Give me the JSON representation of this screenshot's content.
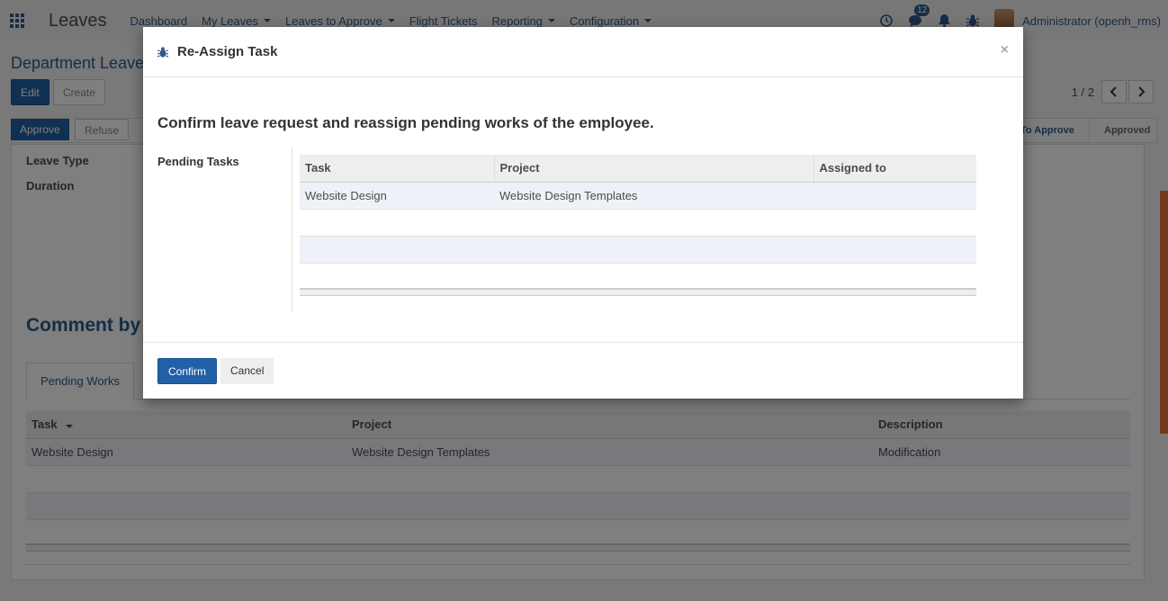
{
  "navbar": {
    "app_name": "Leaves",
    "menu": [
      "Dashboard",
      "My Leaves",
      "Leaves to Approve",
      "Flight Tickets",
      "Reporting",
      "Configuration"
    ],
    "messages_badge": "12",
    "user": "Administrator (openh_rms)"
  },
  "control_panel": {
    "breadcrumb": "Department Leave",
    "edit_label": "Edit",
    "create_label": "Create",
    "pager": "1 / 2"
  },
  "statusbar": {
    "approve_label": "Approve",
    "refuse_label": "Refuse",
    "stage_active": "To Approve",
    "stage_approved": "Approved"
  },
  "form": {
    "leave_type_label": "Leave Type",
    "duration_label": "Duration",
    "comment_title": "Comment by M",
    "tab_pending_works": "Pending Works",
    "table": {
      "columns": [
        "Task",
        "Project",
        "Description"
      ],
      "rows": [
        {
          "task": "Website Design",
          "project": "Website Design Templates",
          "description": "Modification"
        }
      ]
    }
  },
  "modal": {
    "title": "Re-Assign Task",
    "heading": "Confirm leave request and reassign pending works of the employee.",
    "pending_tasks_label": "Pending Tasks",
    "table": {
      "columns": [
        "Task",
        "Project",
        "Assigned to"
      ],
      "rows": [
        {
          "task": "Website Design",
          "project": "Website Design Templates",
          "assigned_to": ""
        }
      ]
    },
    "confirm_label": "Confirm",
    "cancel_label": "Cancel",
    "close_symbol": "×"
  },
  "colors": {
    "primary": "#2160a8",
    "link": "#2c5b8a",
    "row_highlight": "#eef2f8",
    "scrollbar": "#e3753a"
  }
}
